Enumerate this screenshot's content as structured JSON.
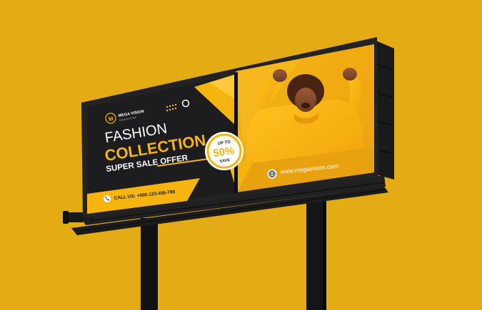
{
  "brand": {
    "logo_letter": "M",
    "name": "MEGA VISION",
    "tagline": "FASHION STORE"
  },
  "headline": {
    "line1": "FASHION",
    "line2": "COLLECTION",
    "line3": "SUPER SALE OFFER"
  },
  "badge": {
    "top": "UP TO",
    "value": "50%",
    "bottom": "SAVE"
  },
  "contact": {
    "label": "CALL US: +000-123-456-789"
  },
  "website": {
    "url": "www.megavision.com"
  },
  "colors": {
    "background": "#e3ac14",
    "accent": "#f6b40e",
    "panel": "#1d1d1f",
    "frame": "#232324"
  },
  "icons": [
    "logo-icon",
    "phone-icon",
    "globe-icon"
  ]
}
